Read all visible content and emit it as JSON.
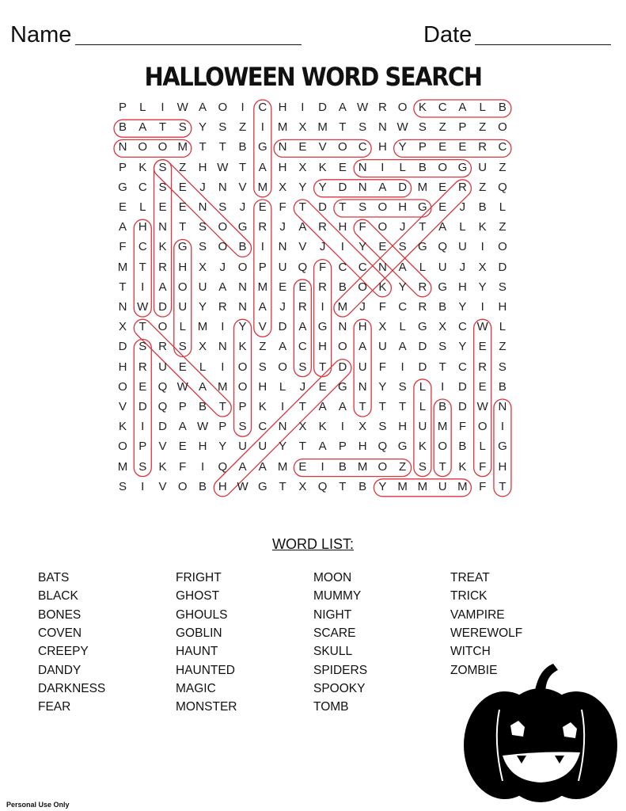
{
  "header": {
    "name_label": "Name",
    "date_label": "Date"
  },
  "title": "HALLOWEEN WORD SEARCH",
  "grid": [
    "PLIWAOICHIDAWROKCALB",
    "BATSYSZIMXMTSNWSZPZO",
    "NOOMTTBGNEVOCHYPEERC",
    "PKSZHWTAHXKENILBOGUZ",
    "GCSEJNVMXYYDNADMERZQ",
    "ELEENSJEFTDTSOHGEJBL",
    "AHNTSOGRJARHFOJTALKZ",
    "FCKGSOBINVJIYESGQUIO",
    "MTRHXJOPUQFCCNALUJXD",
    "TIAOUANMEERBOKYRGHYS",
    "NWDUYRNAJRIMJFCRBYIH",
    "XTOLMIYVDAGNHXLGXCWL",
    "DSRSXNKZACHOAUADSYEZ",
    "HRUELIOSOSTDUFIDTCRS",
    "OEQWAMOHLJEGNYSLIDEB",
    "VDQPBTPKITAATTTLBDWN",
    "KIDAWPSCNXKIXSHUMFOI",
    "OPVEHYUUYTAPHQGKOBLG",
    "MSKFIQAAMEIBMOZSTKFH",
    "SIVOBHWGTXQTBYMMUMFT"
  ],
  "answers": [
    {
      "word": "BLACK",
      "from": [
        0,
        19
      ],
      "to": [
        0,
        15
      ]
    },
    {
      "word": "BATS",
      "from": [
        1,
        0
      ],
      "to": [
        1,
        3
      ]
    },
    {
      "word": "MOON",
      "from": [
        2,
        3
      ],
      "to": [
        2,
        0
      ]
    },
    {
      "word": "COVEN",
      "from": [
        2,
        12
      ],
      "to": [
        2,
        8
      ]
    },
    {
      "word": "CREEPY",
      "from": [
        2,
        19
      ],
      "to": [
        2,
        14
      ]
    },
    {
      "word": "GOBLIN",
      "from": [
        3,
        17
      ],
      "to": [
        3,
        12
      ]
    },
    {
      "word": "MAGIC",
      "from": [
        4,
        7
      ],
      "to": [
        0,
        7
      ]
    },
    {
      "word": "DANDY",
      "from": [
        4,
        14
      ],
      "to": [
        4,
        10
      ]
    },
    {
      "word": "GHOST",
      "from": [
        5,
        15
      ],
      "to": [
        5,
        11
      ]
    },
    {
      "word": "DARKNESS",
      "from": [
        10,
        2
      ],
      "to": [
        3,
        2
      ]
    },
    {
      "word": "BONES",
      "from": [
        7,
        6
      ],
      "to": [
        3,
        2
      ]
    },
    {
      "word": "WITCH",
      "from": [
        10,
        1
      ],
      "to": [
        6,
        1
      ]
    },
    {
      "word": "GHOULS",
      "from": [
        7,
        3
      ],
      "to": [
        12,
        3
      ]
    },
    {
      "word": "VAMPIRE",
      "from": [
        11,
        7
      ],
      "to": [
        5,
        7
      ]
    },
    {
      "word": "FRIGHT",
      "from": [
        8,
        10
      ],
      "to": [
        13,
        10
      ]
    },
    {
      "word": "SCARE",
      "from": [
        13,
        9
      ],
      "to": [
        9,
        9
      ]
    },
    {
      "word": "TRICK",
      "from": [
        5,
        9
      ],
      "to": [
        9,
        13
      ]
    },
    {
      "word": "FEAR",
      "from": [
        6,
        12
      ],
      "to": [
        9,
        15
      ]
    },
    {
      "word": "MONSTER",
      "from": [
        10,
        11
      ],
      "to": [
        4,
        17
      ]
    },
    {
      "word": "MUMMY",
      "from": [
        19,
        17
      ],
      "to": [
        19,
        13
      ]
    },
    {
      "word": "TOMB",
      "from": [
        18,
        16
      ],
      "to": [
        15,
        16
      ]
    },
    {
      "word": "SKULL",
      "from": [
        18,
        15
      ],
      "to": [
        14,
        15
      ]
    },
    {
      "word": "HAUNT",
      "from": [
        11,
        12
      ],
      "to": [
        15,
        12
      ]
    },
    {
      "word": "WEREWOLF",
      "from": [
        11,
        18
      ],
      "to": [
        18,
        18
      ]
    },
    {
      "word": "NIGHT",
      "from": [
        15,
        19
      ],
      "to": [
        19,
        19
      ]
    },
    {
      "word": "ZOMBIE",
      "from": [
        18,
        14
      ],
      "to": [
        18,
        9
      ]
    },
    {
      "word": "SPOOKY",
      "from": [
        16,
        6
      ],
      "to": [
        11,
        6
      ]
    },
    {
      "word": "SPIDERS",
      "from": [
        18,
        1
      ],
      "to": [
        12,
        1
      ]
    },
    {
      "word": "TREAT",
      "from": [
        11,
        1
      ],
      "to": [
        15,
        5
      ]
    },
    {
      "word": "HAUNTED",
      "from": [
        19,
        5
      ],
      "to": [
        13,
        11
      ]
    }
  ],
  "highlight_color": "#d9363e",
  "word_list": {
    "title": "WORD LIST:",
    "columns": [
      [
        "BATS",
        "BLACK",
        "BONES",
        "COVEN",
        "CREEPY",
        "DANDY",
        "DARKNESS",
        "FEAR"
      ],
      [
        "FRIGHT",
        "GHOST",
        "GHOULS",
        "GOBLIN",
        "HAUNT",
        "HAUNTED",
        "MAGIC",
        "MONSTER"
      ],
      [
        "MOON",
        "MUMMY",
        "NIGHT",
        "SCARE",
        "SKULL",
        "SPIDERS",
        "SPOOKY",
        "TOMB"
      ],
      [
        "TREAT",
        "TRICK",
        "VAMPIRE",
        "WEREWOLF",
        "WITCH",
        "ZOMBIE"
      ]
    ]
  },
  "footer": "Personal Use Only"
}
